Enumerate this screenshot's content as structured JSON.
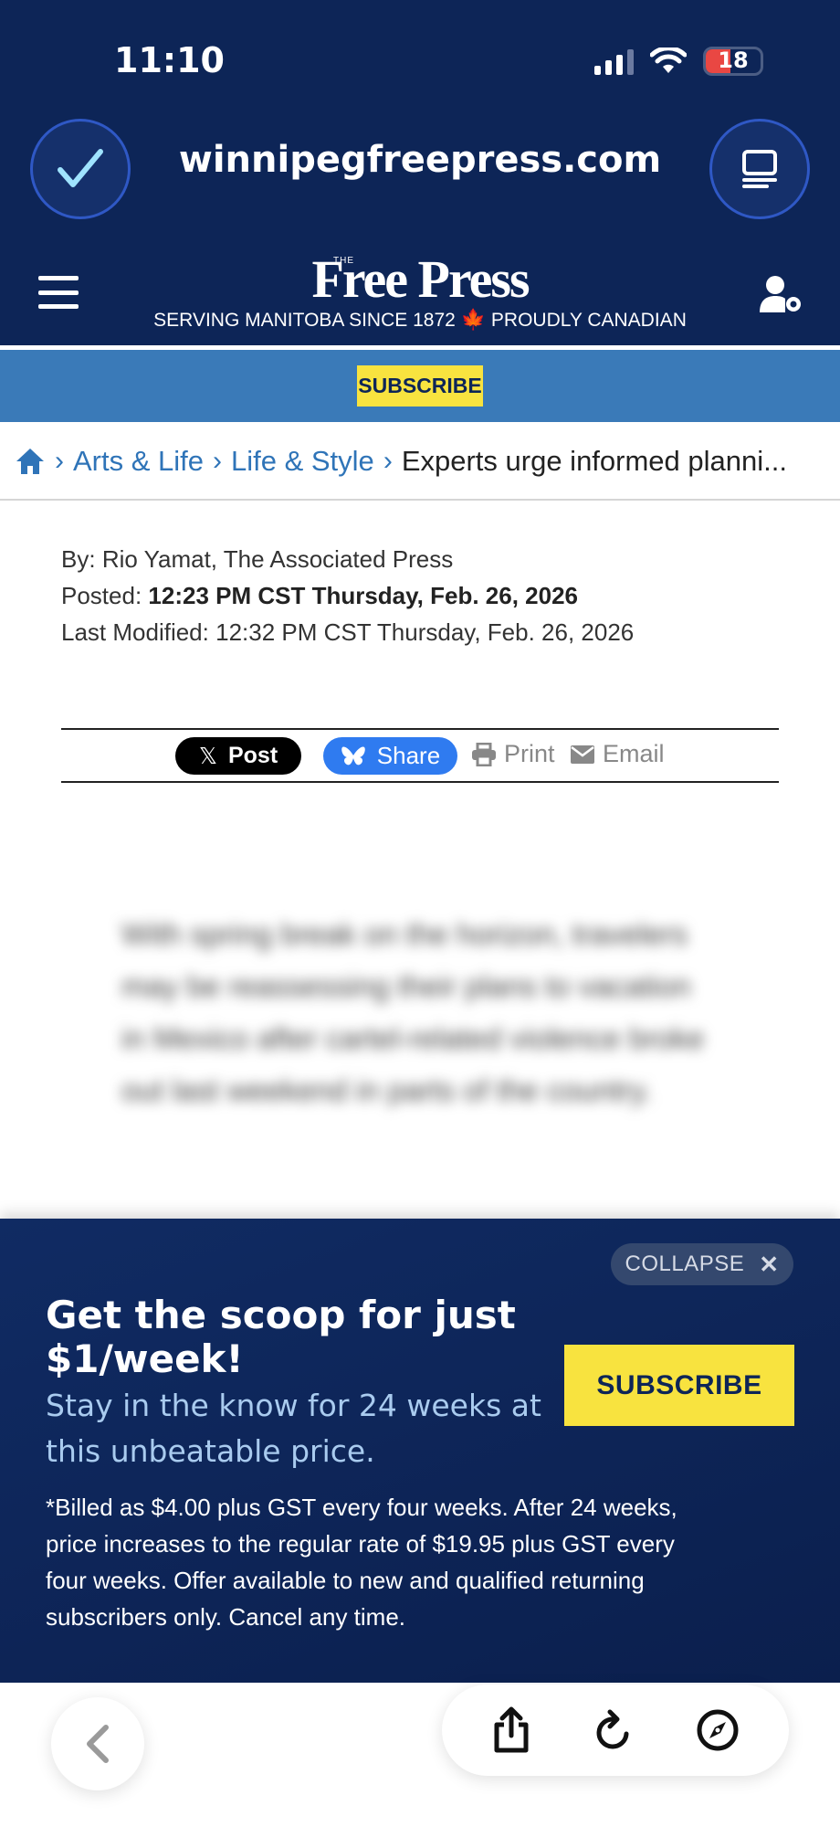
{
  "status_bar": {
    "time": "11:10",
    "battery": "18"
  },
  "browser": {
    "url": "winnipegfreepress.com"
  },
  "site": {
    "logo_small": "THE",
    "logo": "Free Press",
    "tagline_left": "SERVING MANITOBA SINCE 1872",
    "tagline_right": "PROUDLY CANADIAN",
    "subscribe_label": "SUBSCRIBE"
  },
  "breadcrumb": {
    "items": [
      "Arts & Life",
      "Life & Style"
    ],
    "current": "Experts urge informed planni..."
  },
  "article": {
    "byline_label": "By:",
    "byline": "Rio Yamat, The Associated Press",
    "posted_label": "Posted:",
    "posted": "12:23 PM CST Thursday, Feb. 26, 2026",
    "modified_label": "Last Modified:",
    "modified": "12:32 PM CST Thursday, Feb. 26, 2026",
    "body_blurred": "With spring break on the horizon, travelers may be reassessing their plans to vacation in Mexico after cartel-related violence broke out last weekend in parts of the country."
  },
  "share": {
    "x_post": "Post",
    "bluesky": "Share",
    "print": "Print",
    "email": "Email"
  },
  "promo": {
    "collapse_label": "COLLAPSE",
    "title": "Get the scoop for just $1/week!",
    "subtitle": "Stay in the know for 24 weeks at this unbeatable price.",
    "button_label": "SUBSCRIBE",
    "fine_print": "*Billed as $4.00 plus GST every four weeks. After 24 weeks, price increases to the regular rate of $19.95 plus GST every four weeks. Offer available to new and qualified returning subscribers only. Cancel any time."
  },
  "colors": {
    "navy": "#0d2557",
    "subscribe_yellow": "#f8e33f",
    "link_blue": "#2f74b8",
    "bluesky_blue": "#2f7bf0"
  }
}
